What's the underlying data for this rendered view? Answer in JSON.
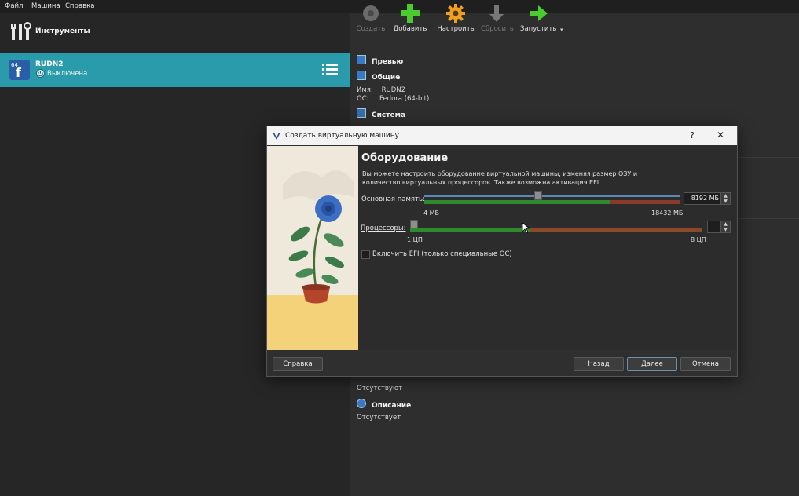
{
  "menubar": {
    "items": [
      "Файл",
      "Машина",
      "Справка"
    ]
  },
  "tools": {
    "label": "Инструменты"
  },
  "vm": {
    "name": "RUDN2",
    "state": "Выключена"
  },
  "toolbar": {
    "create": "Создать",
    "add": "Добавить",
    "settings": "Настроить",
    "discard": "Сбросить",
    "start": "Запустить"
  },
  "details": {
    "preview": "Превью",
    "general": "Общие",
    "name_label": "Имя:",
    "name_value": "RUDN2",
    "os_label": "ОС:",
    "os_value": "Fedora (64-bit)",
    "system": "Система",
    "absent1": "Отсутствуют",
    "description": "Описание",
    "absent2": "Отсутствует"
  },
  "dialog": {
    "title": "Создать виртуальную машину",
    "help_glyph": "?",
    "close_glyph": "✕",
    "heading": "Оборудование",
    "description": "Вы можете настроить оборудование виртуальной машины, изменяя размер ОЗУ и количество виртуальных процессоров. Также возможна активация EFI.",
    "memory_label": "Основная память:",
    "memory_value": "8192 МБ",
    "memory_min": "4 МБ",
    "memory_max": "18432 МБ",
    "memory_fraction": 0.445,
    "cpu_label": "Процессоры:",
    "cpu_value": "1",
    "cpu_min": "1 ЦП",
    "cpu_max": "8 ЦП",
    "cpu_fraction": 0.0,
    "efi_label": "Включить EFI (только специальные ОС)",
    "efi_checked": false,
    "help_button": "Справка",
    "back_button": "Назад",
    "next_button": "Далее",
    "cancel_button": "Отмена"
  },
  "colors": {
    "accent": "#2a9bab",
    "slider_green": "#3a9a3a",
    "slider_red": "#8a3a2a",
    "slider_orange": "#8a4a2a"
  }
}
